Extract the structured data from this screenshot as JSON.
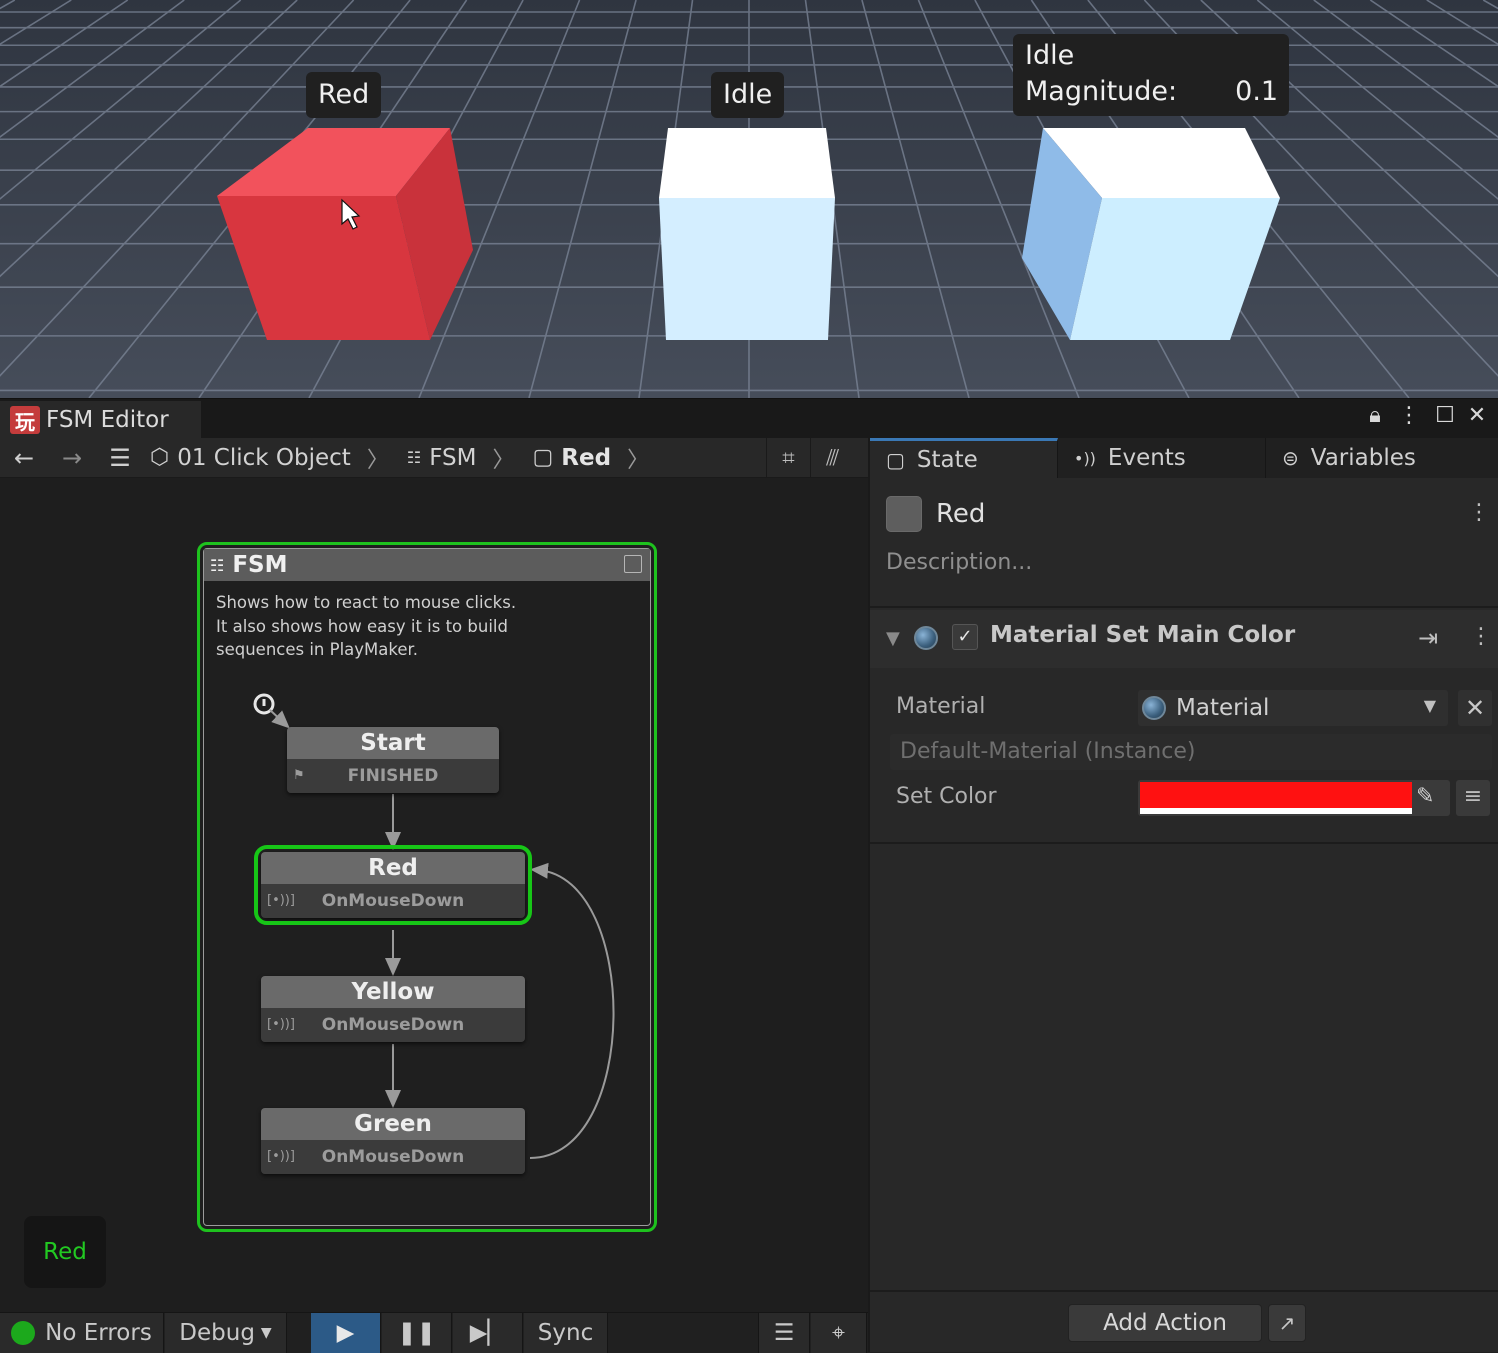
{
  "scene": {
    "labels": [
      {
        "lines": [
          "Red"
        ]
      },
      {
        "lines": [
          "Idle"
        ]
      },
      {
        "title": "Idle",
        "key": "Magnitude:",
        "value": "0.1"
      }
    ],
    "colors": {
      "red_cube": "#e0414c",
      "white_cube": "#e6f6ff",
      "blue_cube": "#cfeeff",
      "grid_bg": "#3d4451"
    }
  },
  "window": {
    "tab_title": "FSM Editor",
    "logo_glyph": "玩",
    "controls": [
      "lock-icon",
      "more-icon",
      "maximize-icon",
      "close-icon"
    ]
  },
  "toolbar": {
    "breadcrumbs": [
      {
        "label": "01 Click Object",
        "icon": "gameobject-icon"
      },
      {
        "label": "FSM",
        "icon": "fsm-icon"
      },
      {
        "label": "Red",
        "icon": "state-icon"
      }
    ]
  },
  "graph": {
    "fsm": {
      "title": "FSM",
      "description": [
        "Shows how to react to mouse clicks.",
        "It also shows how easy it is to build",
        "sequences in PlayMaker."
      ]
    },
    "states": [
      {
        "name": "Start",
        "transition": "FINISHED",
        "icon": "finish-flag-icon",
        "selected": false
      },
      {
        "name": "Red",
        "transition": "OnMouseDown",
        "icon": "event-icon",
        "selected": true
      },
      {
        "name": "Yellow",
        "transition": "OnMouseDown",
        "icon": "event-icon",
        "selected": false
      },
      {
        "name": "Green",
        "transition": "OnMouseDown",
        "icon": "event-icon",
        "selected": false
      }
    ],
    "active_state_badge": "Red"
  },
  "statusbar": {
    "errors": "No Errors",
    "debug": "Debug",
    "sync": "Sync"
  },
  "inspector": {
    "tabs": [
      {
        "label": "State",
        "icon": "state-icon",
        "active": true
      },
      {
        "label": "Events",
        "icon": "events-icon",
        "active": false
      },
      {
        "label": "Variables",
        "icon": "variables-icon",
        "active": false
      }
    ],
    "state_name": "Red",
    "description_placeholder": "Description...",
    "action": {
      "title": "Material Set Main Color",
      "enabled": true,
      "material_label": "Material",
      "material_value": "Material",
      "material_instance": "Default-Material (Instance)",
      "color_label": "Set Color",
      "color_value": "#ff1111"
    },
    "add_action": "Add Action"
  }
}
